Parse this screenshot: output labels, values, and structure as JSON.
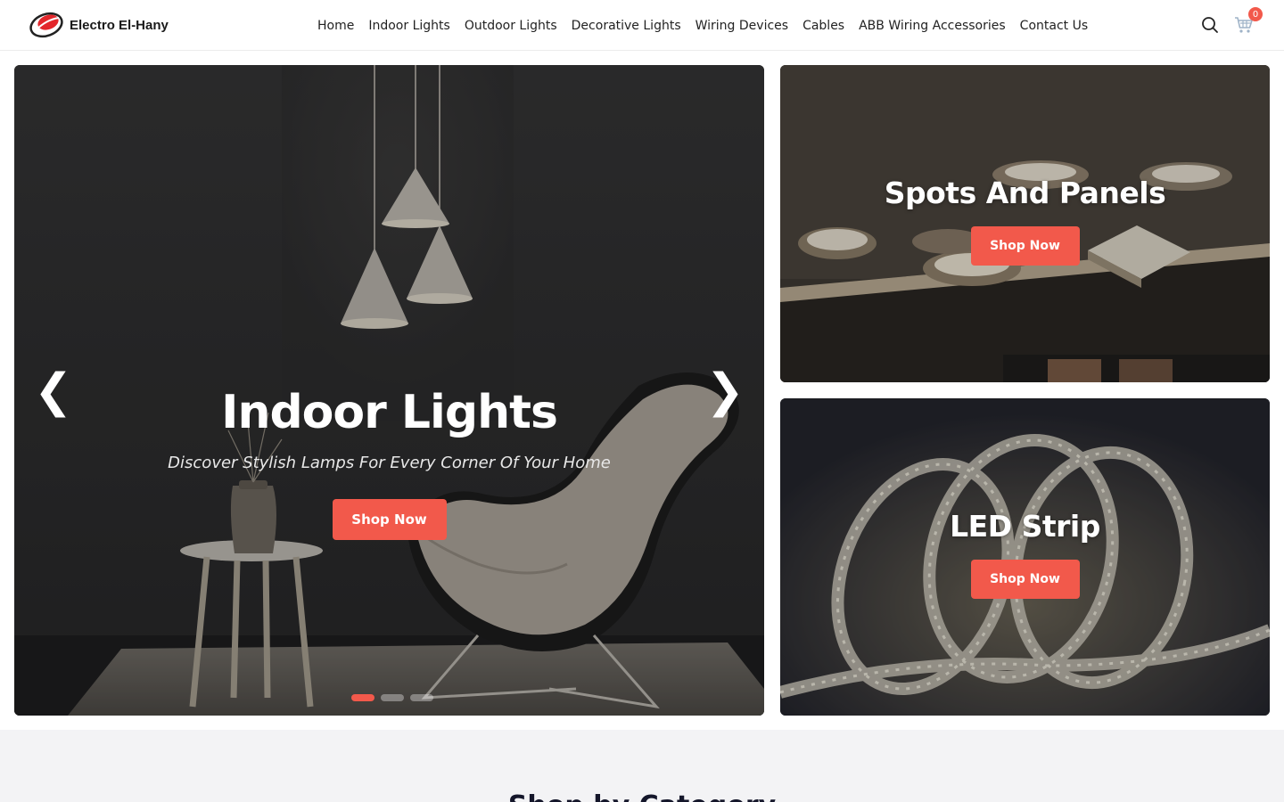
{
  "brand": {
    "name": "Electro El-Hany",
    "accent": "#f2594b"
  },
  "nav": {
    "items": [
      {
        "label": "Home"
      },
      {
        "label": "Indoor Lights"
      },
      {
        "label": "Outdoor Lights"
      },
      {
        "label": "Decorative Lights"
      },
      {
        "label": "Wiring Devices"
      },
      {
        "label": "Cables"
      },
      {
        "label": "ABB Wiring Accessories"
      },
      {
        "label": "Contact Us"
      }
    ]
  },
  "header_actions": {
    "search_icon": "search-icon",
    "cart_icon": "cart-icon",
    "cart_count": "0"
  },
  "hero": {
    "title": "Indoor Lights",
    "subtitle": "Discover Stylish Lamps For Every Corner Of Your Home",
    "cta": "Shop Now",
    "prev": "❮",
    "next": "❯",
    "slides_total": 3,
    "active_slide": 1
  },
  "banners": [
    {
      "title": "Spots And Panels",
      "cta": "Shop Now"
    },
    {
      "title": "LED Strip",
      "cta": "Shop Now"
    }
  ],
  "section": {
    "heading": "Shop by Category"
  }
}
